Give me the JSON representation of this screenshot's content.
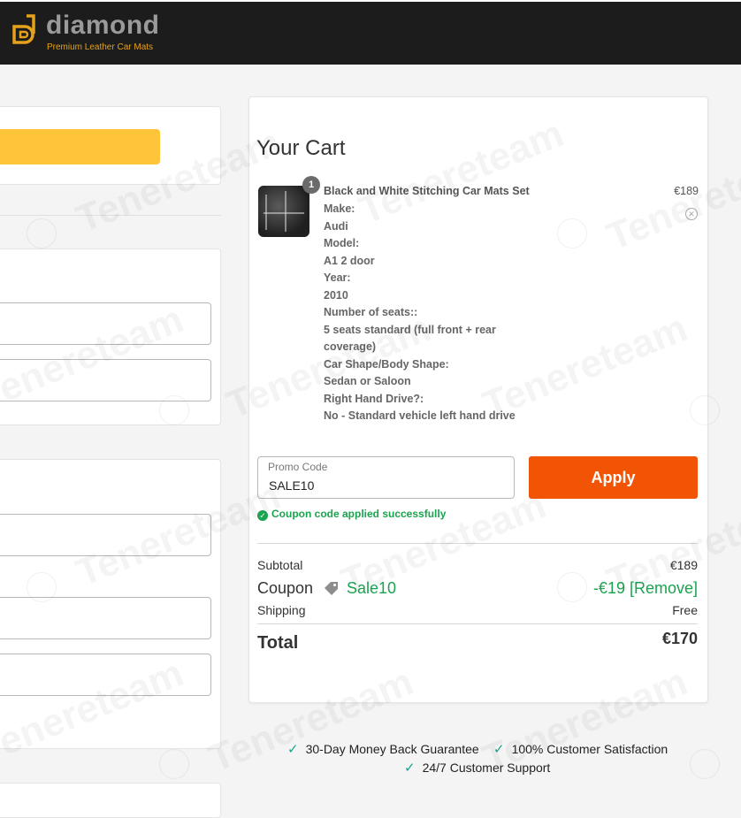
{
  "header": {
    "brand": "diamond",
    "tagline": "Premium Leather Car Mats",
    "colors": {
      "bar": "#1c1c1c",
      "accent": "#e6a11c"
    }
  },
  "cart": {
    "title": "Your Cart",
    "item": {
      "quantity": "1",
      "name": "Black and White Stitching Car Mats Set",
      "price": "€189",
      "options": [
        "Make:",
        "Audi",
        "Model:",
        "A1 2 door",
        "Year:",
        "2010",
        "Number of seats::",
        "5 seats standard (full front + rear coverage)",
        "Car Shape/Body Shape:",
        "Sedan or Saloon",
        "Right Hand Drive?:",
        "No - Standard vehicle left hand drive"
      ],
      "remove_icon": "close-circle-icon"
    },
    "promo": {
      "label": "Promo Code",
      "value": "SALE10",
      "apply_label": "Apply",
      "success_message": "Coupon code applied successfully"
    },
    "summary": {
      "subtotal_label": "Subtotal",
      "subtotal_value": "€189",
      "coupon_label": "Coupon",
      "coupon_code": "Sale10",
      "coupon_discount": "-€19 [Remove]",
      "shipping_label": "Shipping",
      "shipping_value": "Free",
      "total_label": "Total",
      "total_value": "€170"
    },
    "colors": {
      "apply": "#f25405",
      "success": "#1ba34f"
    }
  },
  "guarantees": [
    "30-Day Money Back Guarantee",
    "100% Customer Satisfaction",
    "24/7 Customer Support"
  ],
  "watermark_text": "Tenereteam"
}
